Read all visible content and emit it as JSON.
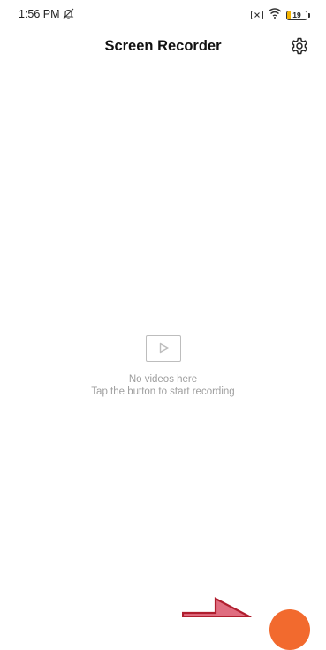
{
  "status_bar": {
    "time": "1:56 PM",
    "battery_level": "19",
    "battery_fraction": 0.19,
    "icons": [
      "do-not-disturb-icon",
      "no-sim-icon",
      "wifi-icon",
      "battery-icon"
    ]
  },
  "header": {
    "title": "Screen Recorder",
    "settings_icon": "gear-icon"
  },
  "empty_state": {
    "icon": "video-play-icon",
    "title": "No videos here",
    "subtitle": "Tap the button to start recording"
  },
  "overlay": {
    "arrow_icon": "pointer-arrow-icon",
    "arrow_color": "#b01e2e"
  },
  "record_button": {
    "icon": "record-icon",
    "color": "#f26a2e"
  }
}
